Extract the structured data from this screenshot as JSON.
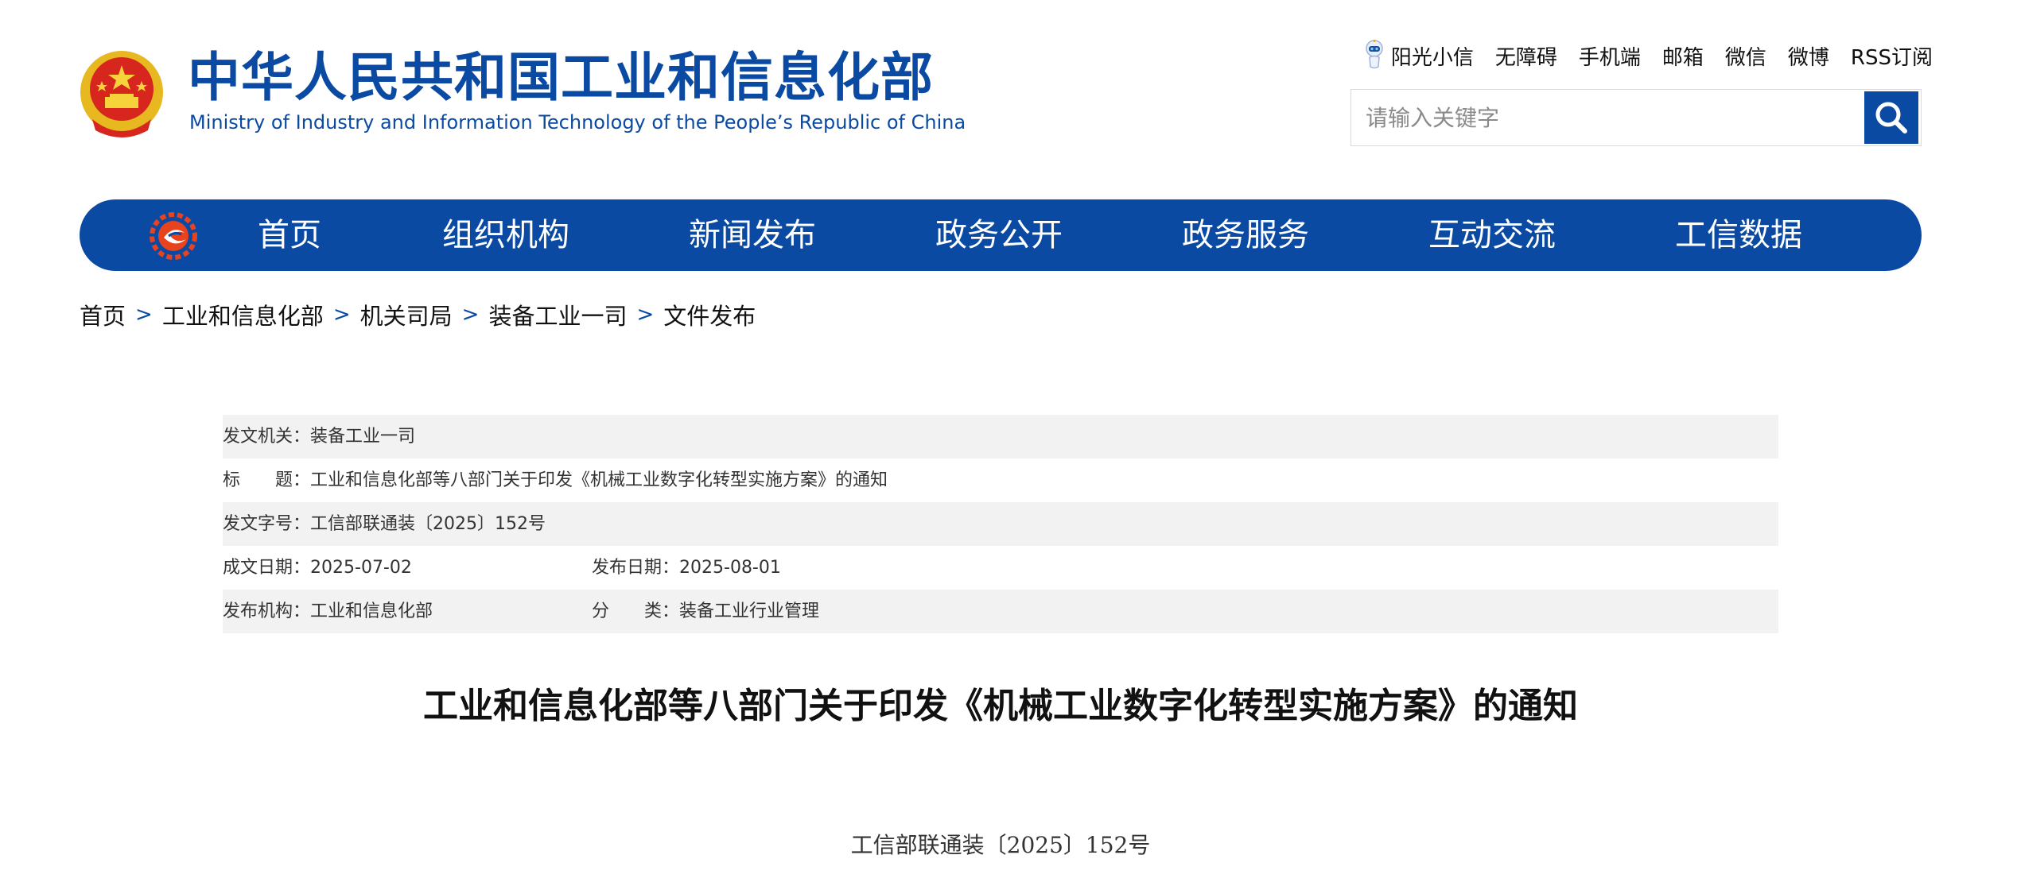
{
  "header": {
    "title_zh": "中华人民共和国工业和信息化部",
    "title_en": "Ministry of Industry and Information Technology of the People’s Republic of China",
    "top_links": [
      "阳光小信",
      "无障碍",
      "手机端",
      "邮箱",
      "微信",
      "微博",
      "RSS订阅"
    ],
    "search_placeholder": "请输入关键字",
    "brand_color": "#0b4aa2"
  },
  "nav": {
    "items": [
      "首页",
      "组织机构",
      "新闻发布",
      "政务公开",
      "政务服务",
      "互动交流",
      "工信数据"
    ]
  },
  "breadcrumb": {
    "items": [
      "首页",
      "工业和信息化部",
      "机关司局",
      "装备工业一司",
      "文件发布"
    ],
    "separator": ">"
  },
  "meta": {
    "issuer_label": "发文机关：",
    "issuer": "装备工业一司",
    "title_label": "标　　题：",
    "title": "工业和信息化部等八部门关于印发《机械工业数字化转型实施方案》的通知",
    "doc_no_label": "发文字号：",
    "doc_no": "工信部联通装〔2025〕152号",
    "created_label": "成文日期：",
    "created": "2025-07-02",
    "published_label": "发布日期：",
    "published": "2025-08-01",
    "agency_label": "发布机构：",
    "agency": "工业和信息化部",
    "category_label": "分　　类：",
    "category": "装备工业行业管理"
  },
  "article": {
    "title": "工业和信息化部等八部门关于印发《机械工业数字化转型实施方案》的通知",
    "doc_number": "工信部联通装〔2025〕152号"
  }
}
